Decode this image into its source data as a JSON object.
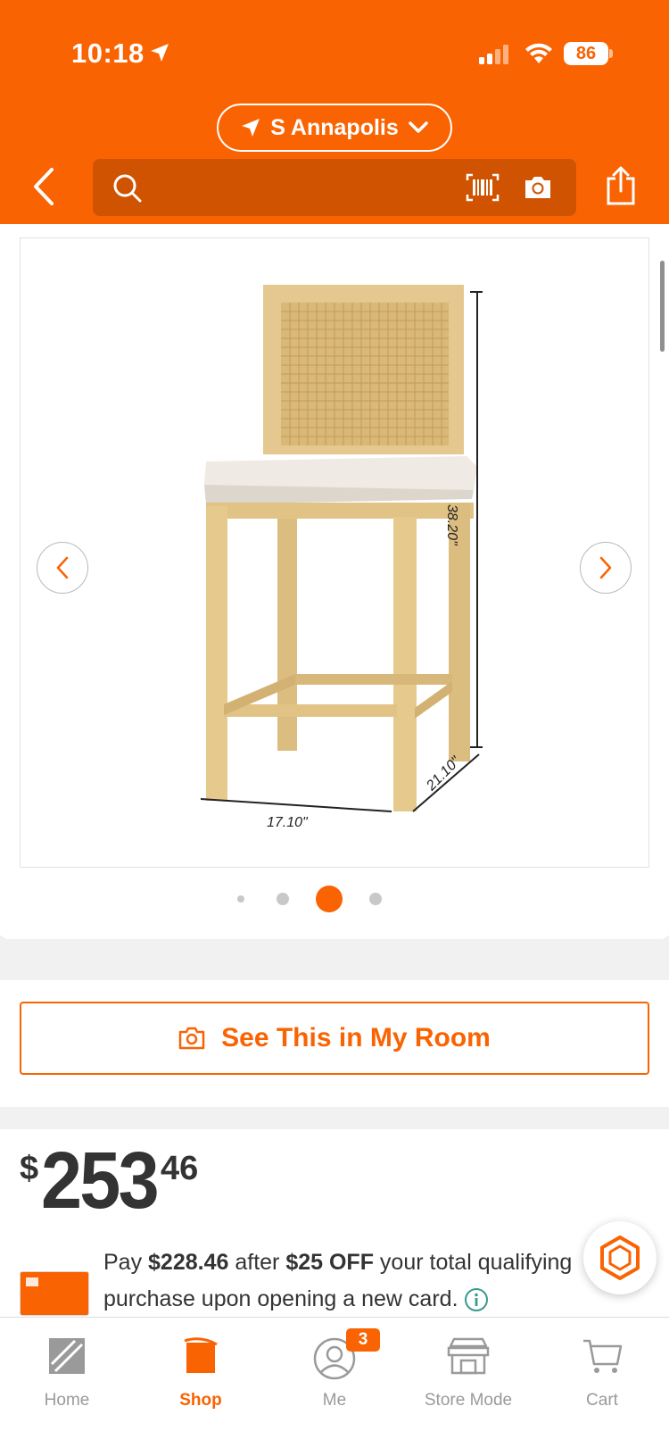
{
  "status_bar": {
    "time": "10:18",
    "battery": "86"
  },
  "header": {
    "location": "S Annapolis",
    "search_placeholder": ""
  },
  "gallery": {
    "dimension_height": "38.20\"",
    "dimension_width": "17.10\"",
    "dimension_depth": "21.10\"",
    "active_index": 2,
    "dot_count": 4
  },
  "see_in_room": {
    "label": "See This in My Room"
  },
  "price": {
    "currency": "$",
    "dollars": "253",
    "cents": "46"
  },
  "promo": {
    "prefix": "Pay ",
    "amount": "$228.46",
    "middle": " after ",
    "discount": "$25 OFF",
    "suffix_line1": " your total qualifying",
    "line2": "purchase upon opening a new card."
  },
  "tabbar": {
    "items": [
      {
        "label": "Home",
        "icon": "home-depot-logo-icon",
        "active": false
      },
      {
        "label": "Shop",
        "icon": "paint-bucket-icon",
        "active": true
      },
      {
        "label": "Me",
        "icon": "person-icon",
        "active": false,
        "badge": "3"
      },
      {
        "label": "Store Mode",
        "icon": "store-icon",
        "active": false
      },
      {
        "label": "Cart",
        "icon": "cart-icon",
        "active": false
      }
    ]
  },
  "colors": {
    "brand": "#f96302",
    "text": "#333333",
    "muted": "#9a9a9a",
    "info": "#3a9a8c"
  }
}
